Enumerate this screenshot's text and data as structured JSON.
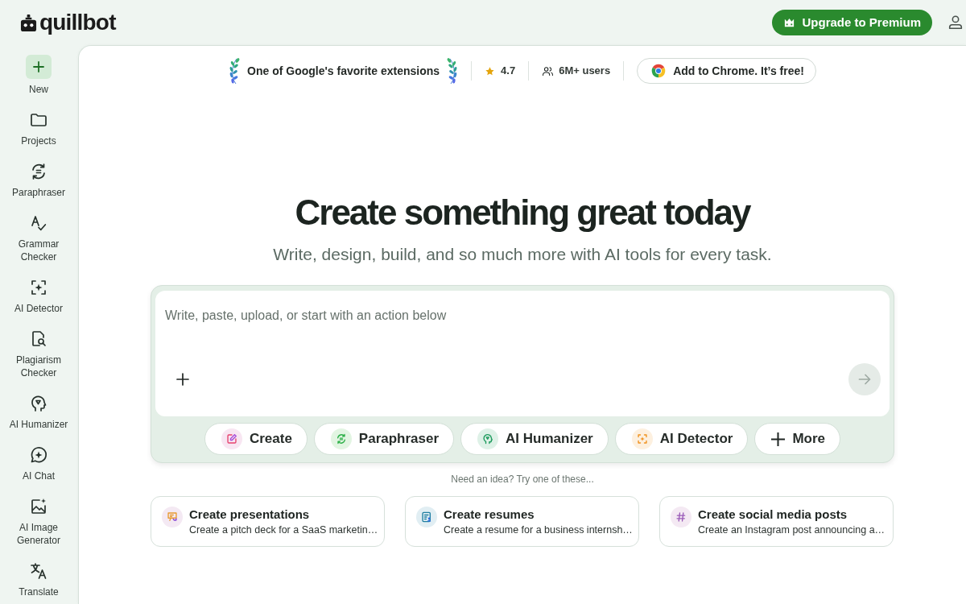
{
  "header": {
    "logo": "quillbot",
    "upgrade_button": "Upgrade to Premium"
  },
  "sidebar": {
    "items": [
      {
        "kind": "new",
        "label": "New"
      },
      {
        "kind": "link",
        "label": "Projects"
      },
      {
        "kind": "link",
        "label": "Paraphraser"
      },
      {
        "kind": "link",
        "label": "Grammar Checker"
      },
      {
        "kind": "link",
        "label": "AI Detector"
      },
      {
        "kind": "link",
        "label": "Plagiarism Checker"
      },
      {
        "kind": "link",
        "label": "AI Humanizer"
      },
      {
        "kind": "link",
        "label": "AI Chat"
      },
      {
        "kind": "link",
        "label": "AI Image Generator"
      },
      {
        "kind": "link",
        "label": "Translate"
      }
    ]
  },
  "banner": {
    "badge": "One of Google's favorite extensions",
    "rating": "4.7",
    "users": "6M+ users",
    "chrome_button": "Add to Chrome. It’s free!"
  },
  "hero": {
    "title": "Create something great today",
    "subtitle": "Write, design, build, and so much more with AI tools for every task."
  },
  "prompt": {
    "placeholder": "Write, paste, upload, or start with an action below",
    "send_disabled": true,
    "actions": [
      "Create",
      "Paraphraser",
      "AI Humanizer",
      "AI Detector",
      "More"
    ]
  },
  "ideas": {
    "hint": "Need an idea? Try one of these...",
    "cards": [
      {
        "title": "Create presentations",
        "description": "Create a pitch deck for a SaaS marketin…"
      },
      {
        "title": "Create resumes",
        "description": "Create a resume for a business internsh…"
      },
      {
        "title": "Create social media posts",
        "description": "Create an Instagram post announcing a…"
      }
    ]
  }
}
